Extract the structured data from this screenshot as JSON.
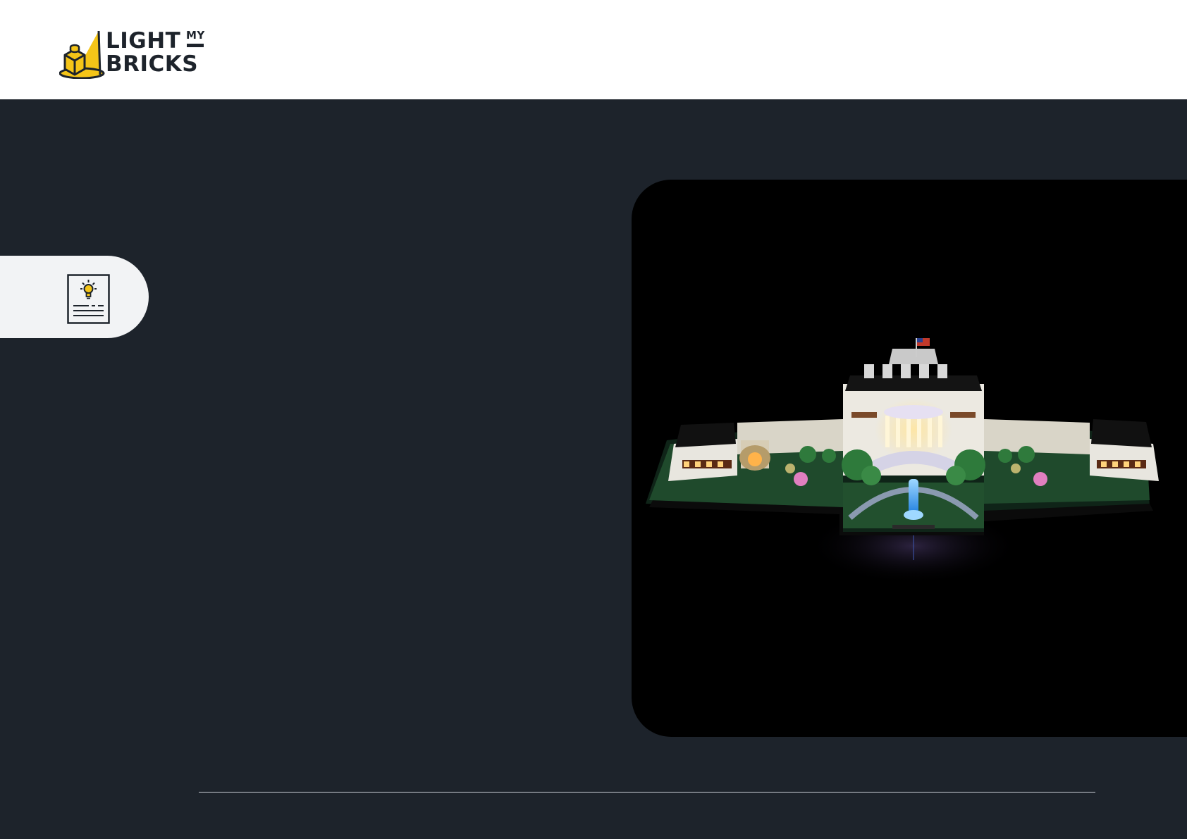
{
  "brand": {
    "logo_line1": "LIGHT",
    "logo_small": "MY",
    "logo_line2": "BRICKS",
    "accent_color": "#f5c518",
    "dark_color": "#1d232b"
  },
  "sidebar": {
    "icon": "idea-document-icon"
  },
  "hero_image": {
    "subject": "illuminated-white-house-brick-model",
    "background_color": "#000000"
  },
  "colors": {
    "page_background": "#1d232b",
    "header_background": "#ffffff",
    "tab_background": "#f2f3f5",
    "divider": "#c9ced6"
  }
}
